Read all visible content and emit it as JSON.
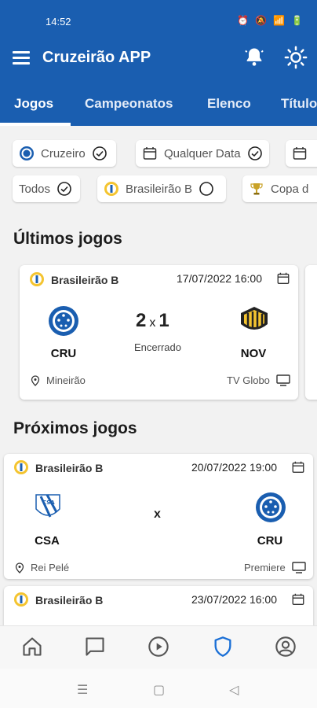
{
  "status_bar": {
    "time": "14:52"
  },
  "app": {
    "title": "Cruzeirão APP"
  },
  "tabs": [
    {
      "label": "Jogos"
    },
    {
      "label": "Campeonatos"
    },
    {
      "label": "Elenco"
    },
    {
      "label": "Títulos"
    }
  ],
  "filters": {
    "row1": [
      {
        "label": "Cruzeiro",
        "icon": "cruzeiro-crest-icon"
      },
      {
        "label": "Qualquer Data",
        "icon": "calendar-icon"
      },
      {
        "label": "",
        "icon": "calendar-icon"
      }
    ],
    "row2": [
      {
        "label": "Todos"
      },
      {
        "label": "Brasileirão B",
        "icon": "brasileirao-b-icon"
      },
      {
        "label": "Copa d",
        "icon": "trophy-icon"
      }
    ]
  },
  "sections": {
    "last": "Últimos jogos",
    "next": "Próximos jogos"
  },
  "last_games": [
    {
      "league": "Brasileirão B",
      "datetime": "17/07/2022 16:00",
      "home": "CRU",
      "away": "NOV",
      "home_score": "2",
      "away_score": "1",
      "separator": "x",
      "status": "Encerrado",
      "venue": "Mineirão",
      "broadcast": "TV Globo"
    }
  ],
  "next_games": [
    {
      "league": "Brasileirão B",
      "datetime": "20/07/2022 19:00",
      "home": "CSA",
      "away": "CRU",
      "separator": "x",
      "venue": "Rei Pelé",
      "broadcast": "Premiere"
    },
    {
      "league": "Brasileirão B",
      "datetime": "23/07/2022 16:00"
    }
  ],
  "colors": {
    "primary": "#1a5eb0",
    "active_nav": "#1a6fd6"
  }
}
